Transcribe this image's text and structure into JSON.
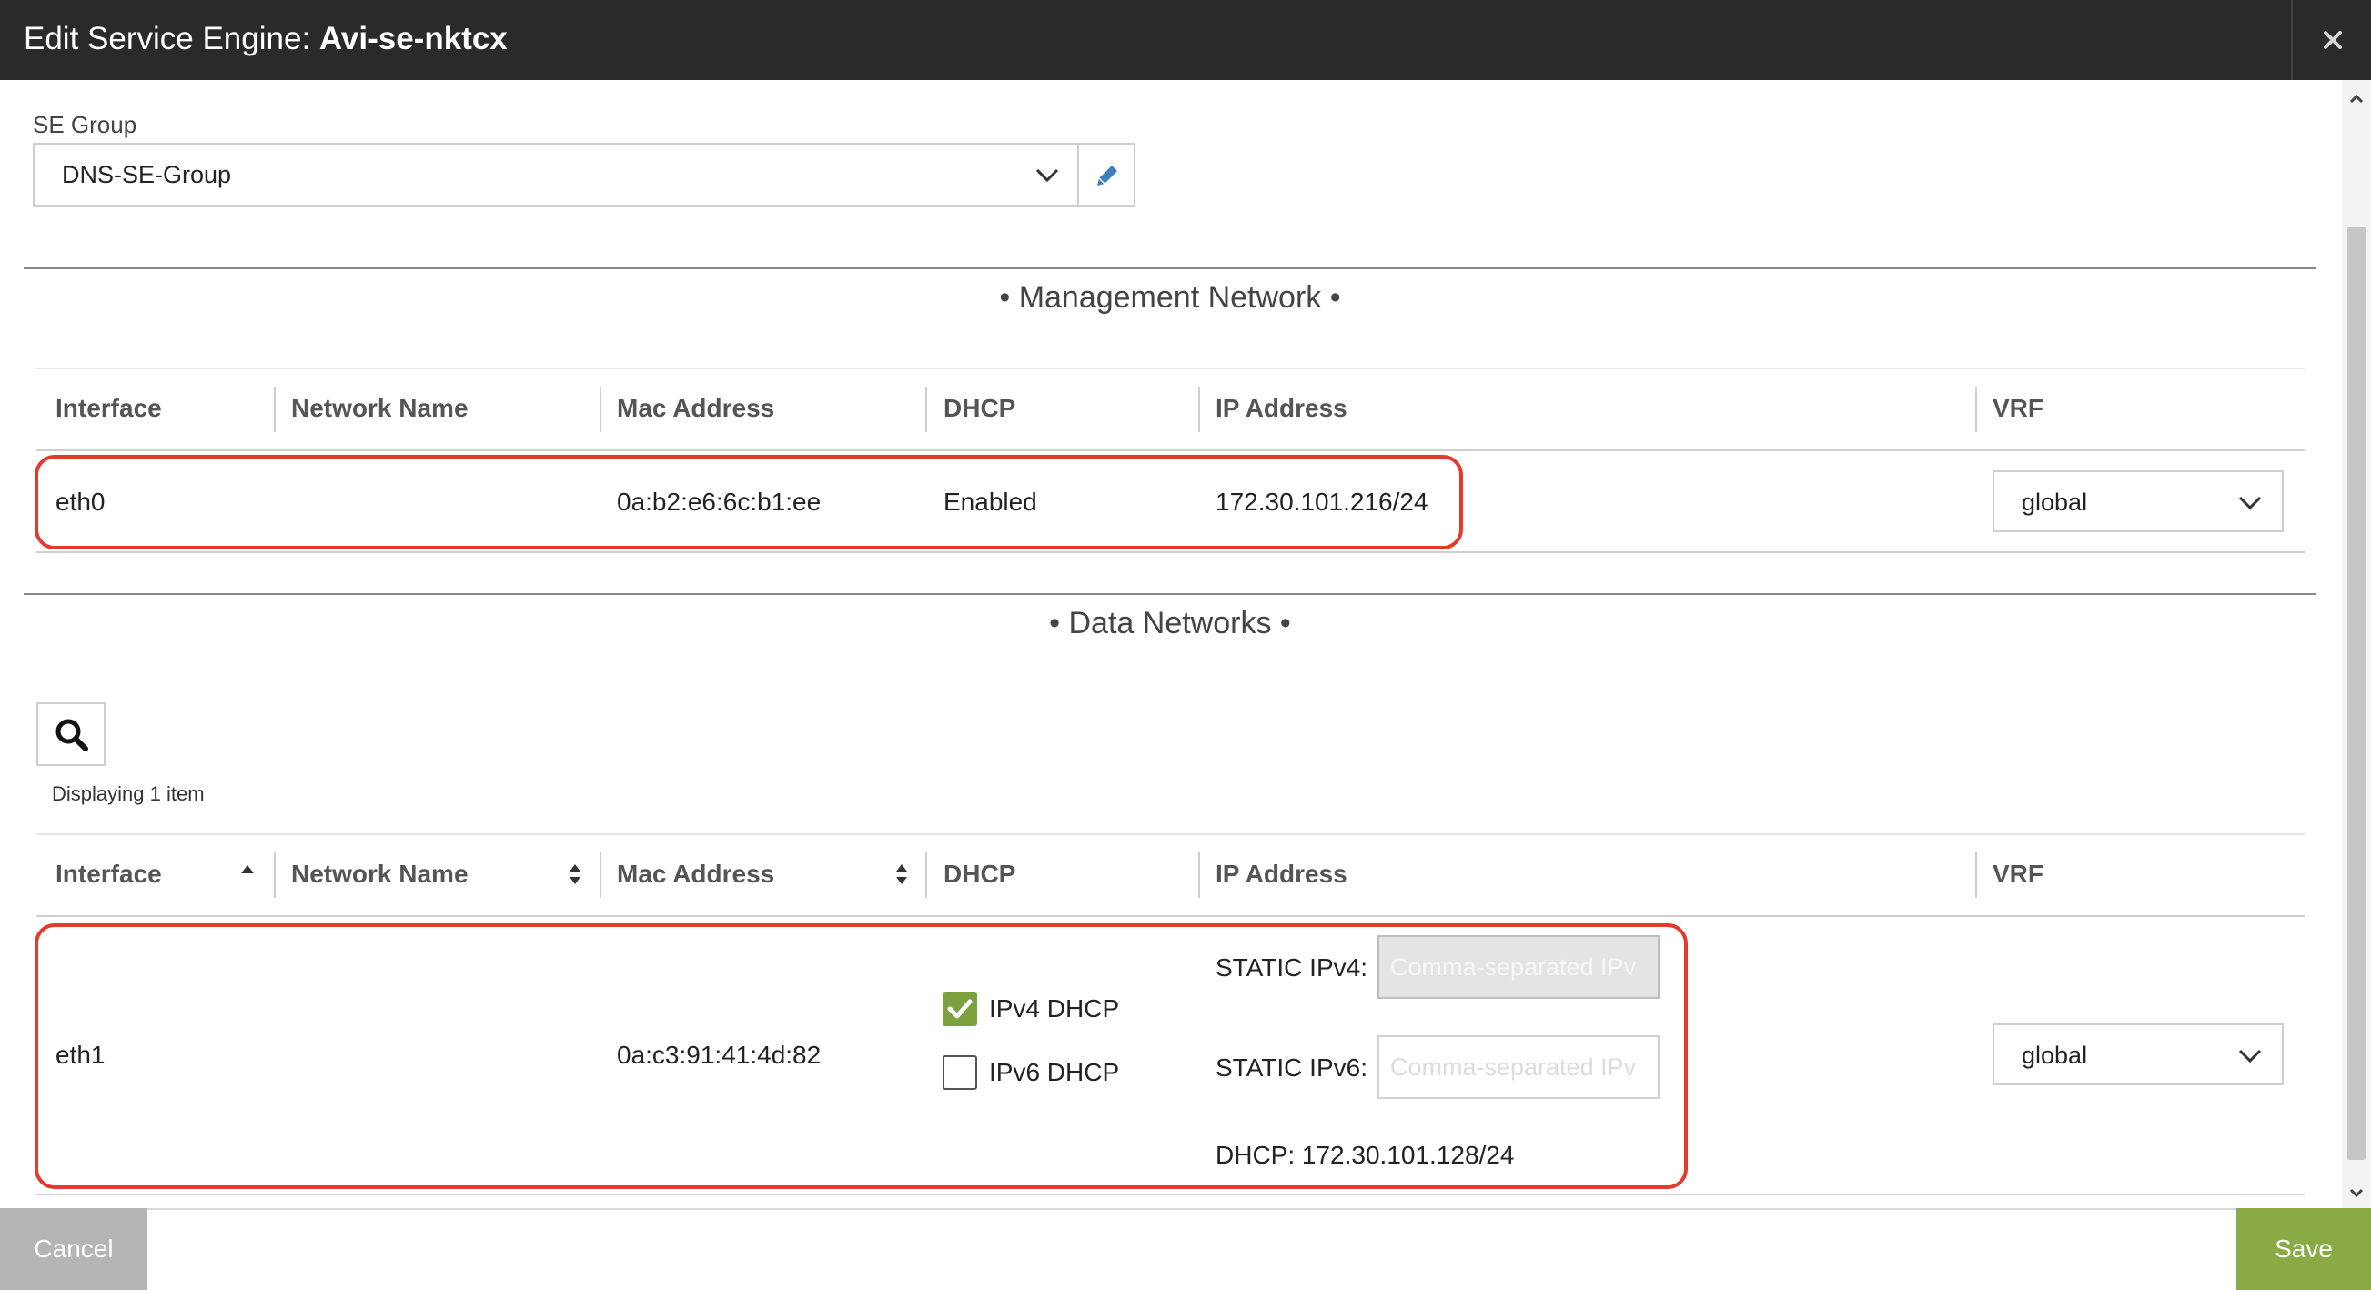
{
  "dialog": {
    "title_prefix": "Edit Service Engine: ",
    "title_name": "Avi-se-nktcx"
  },
  "se_group": {
    "label": "SE Group",
    "value": "DNS-SE-Group"
  },
  "management": {
    "section_title": "• Management Network •",
    "headers": [
      "Interface",
      "Network Name",
      "Mac Address",
      "DHCP",
      "IP Address",
      "VRF"
    ],
    "row": {
      "interface": "eth0",
      "network_name": "",
      "mac": "0a:b2:e6:6c:b1:ee",
      "dhcp": "Enabled",
      "ip": "172.30.101.216/24",
      "vrf": "global"
    }
  },
  "data_networks": {
    "section_title": "• Data Networks •",
    "display_count": "Displaying 1 item",
    "headers": [
      "Interface",
      "Network Name",
      "Mac Address",
      "DHCP",
      "IP Address",
      "VRF"
    ],
    "row": {
      "interface": "eth1",
      "mac": "0a:c3:91:41:4d:82",
      "ipv4_dhcp_label": "IPv4 DHCP",
      "ipv4_dhcp_checked": true,
      "ipv6_dhcp_label": "IPv6 DHCP",
      "ipv6_dhcp_checked": false,
      "static_ipv4_label": "STATIC IPv4:",
      "static_ipv6_label": "STATIC IPv6:",
      "ip_placeholder": "Comma-separated IPv",
      "dhcp_ip": "DHCP: 172.30.101.128/24",
      "vrf": "global"
    }
  },
  "footer": {
    "cancel_label": "Cancel",
    "save_label": "Save"
  },
  "colors": {
    "titlebar": "#2a2a2a",
    "highlight": "#e23b2e",
    "save": "#8aaa46",
    "cancel": "#b5b5b5",
    "checkbox": "#7ba23f"
  },
  "icons": [
    "close-icon",
    "chevron-down-icon",
    "pencil-icon",
    "search-icon",
    "sort-asc-icon",
    "sort-icon",
    "check-icon",
    "scroll-up-icon",
    "scroll-down-icon"
  ]
}
